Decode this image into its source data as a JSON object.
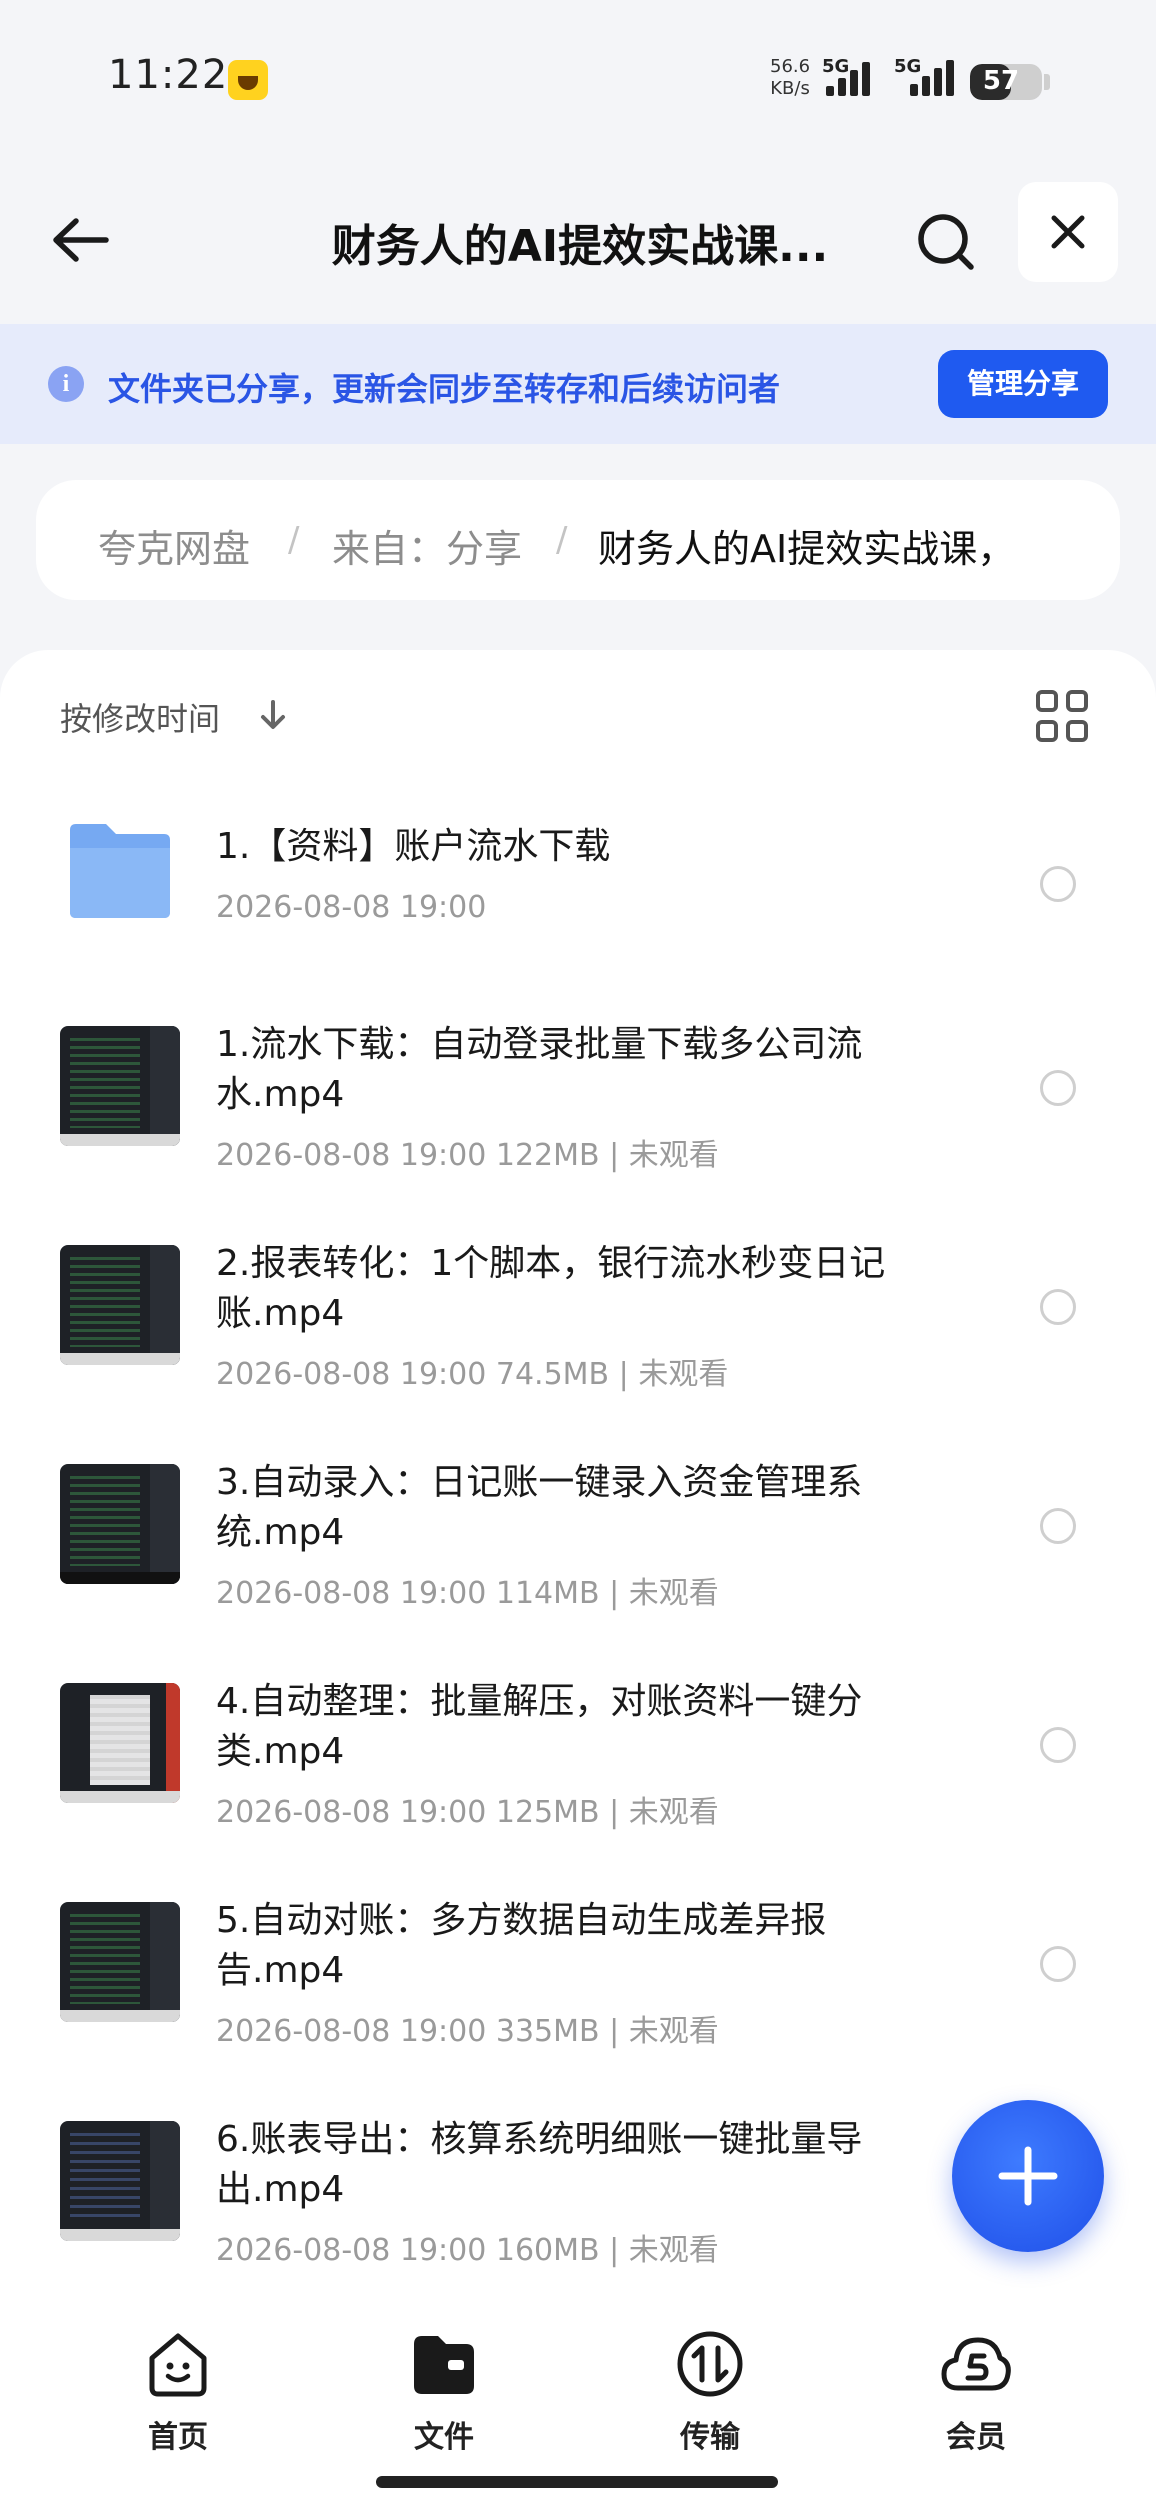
{
  "status_bar": {
    "time": "11:22",
    "net_speed_value": "56.6",
    "net_speed_unit": "KB/s",
    "signal1_label": "5G",
    "signal2_label": "5G",
    "battery": "57",
    "battery_level": 0.57
  },
  "header": {
    "title": "财务人的AI提效实战课...",
    "back_icon": "arrow-left-icon",
    "search_icon": "search-icon",
    "close_icon": "close-icon"
  },
  "banner": {
    "text": "文件夹已分享，更新会同步至转存和后续访问者",
    "button": "管理分享",
    "accent_color": "#1f5af0"
  },
  "breadcrumb": {
    "items": [
      "夸克网盘",
      "来自：分享",
      "财务人的AI提效实战课，"
    ],
    "separator": "/"
  },
  "list": {
    "sort_label": "按修改时间",
    "items": [
      {
        "type": "folder",
        "name": "1.【资料】账户流水下载",
        "meta": "2026-08-08 19:00"
      },
      {
        "type": "video",
        "name": "1.流水下载：自动登录批量下载多公司流水.mp4",
        "meta": "2026-08-08 19:00  122MB | 未观看"
      },
      {
        "type": "video",
        "name": "2.报表转化：1个脚本，银行流水秒变日记账.mp4",
        "meta": "2026-08-08 19:00  74.5MB | 未观看"
      },
      {
        "type": "video",
        "name": "3.自动录入：日记账一键录入资金管理系统.mp4",
        "meta": "2026-08-08 19:00  114MB | 未观看"
      },
      {
        "type": "video",
        "name": "4.自动整理：批量解压，对账资料一键分类.mp4",
        "meta": "2026-08-08 19:00  125MB | 未观看"
      },
      {
        "type": "video",
        "name": "5.自动对账：多方数据自动生成差异报告.mp4",
        "meta": "2026-08-08 19:00  335MB | 未观看"
      },
      {
        "type": "video",
        "name": "6.账表导出：核算系统明细账一键批量导出.mp4",
        "meta": "2026-08-08 19:00  160MB | 未观看"
      }
    ]
  },
  "tabbar": {
    "tabs": [
      {
        "label": "首页",
        "icon": "home-face-icon"
      },
      {
        "label": "文件",
        "icon": "folder-icon"
      },
      {
        "label": "传输",
        "icon": "transfer-icon"
      },
      {
        "label": "会员",
        "icon": "vip-cloud-icon"
      }
    ]
  }
}
